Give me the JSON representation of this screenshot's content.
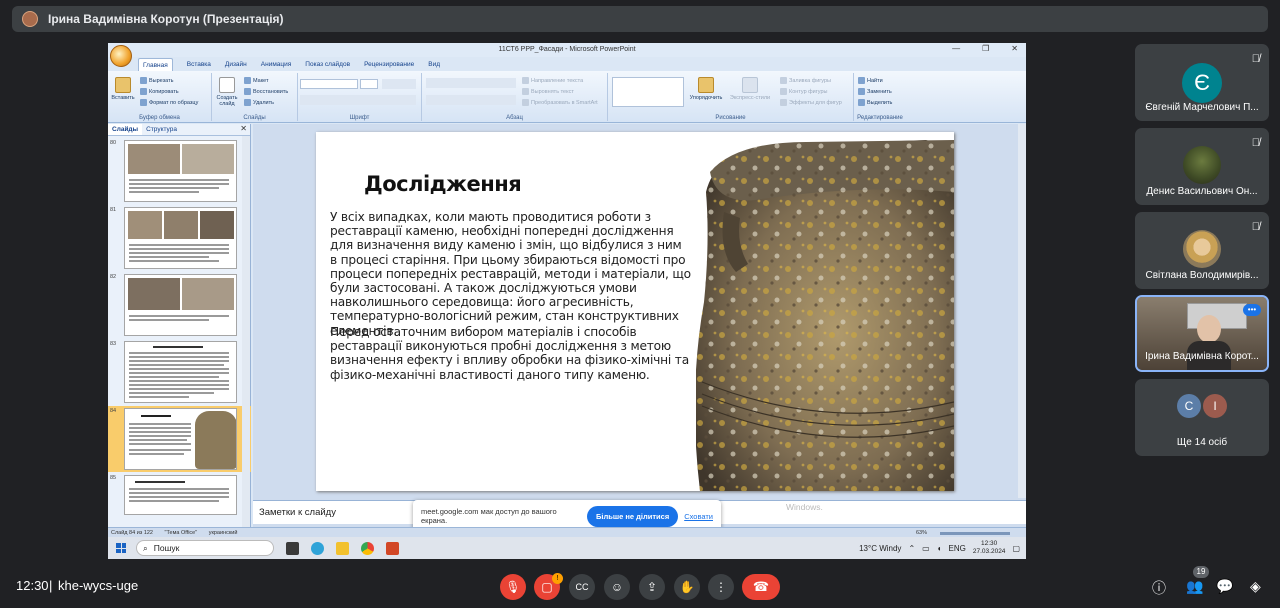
{
  "meet": {
    "presenter_bar": "Ірина Вадимівна Коротун (Презентація)",
    "meeting_time": "12:30",
    "meeting_code": "khe-wycs-uge",
    "people_count": "19",
    "more_people_label": "Ще 14 осіб",
    "participants": [
      {
        "name": "Євгеній Марчелович П...",
        "initial": "Є",
        "avatar_color": "#00838f"
      },
      {
        "name": "Денис Васильович Он..."
      },
      {
        "name": "Світлана Володимирів..."
      },
      {
        "name": "Ірина Вадимівна Корот..."
      }
    ],
    "more_initials": [
      "С",
      "І"
    ],
    "controls": [
      "mic-off-icon",
      "camera-off-icon",
      "captions-icon",
      "emoji-icon",
      "present-icon",
      "raise-hand-icon",
      "more-icon",
      "hang-up-icon"
    ],
    "right_controls": [
      "info-icon",
      "people-icon",
      "chat-icon",
      "activities-icon"
    ],
    "accent": "#ea4335"
  },
  "ppt": {
    "window_title": "11СТ6 PPP_Фасади - Microsoft PowerPoint",
    "tabs": [
      "Главная",
      "Вставка",
      "Дизайн",
      "Анимация",
      "Показ слайдов",
      "Рецензирование",
      "Вид"
    ],
    "clipboard": {
      "paste": "Вставить",
      "cut": "Вырезать",
      "copy": "Копировать",
      "format": "Формат по образцу",
      "label": "Буфер обмена"
    },
    "slides_group": {
      "create": "Создать слайд",
      "layout": "Макет",
      "reset": "Восстановить",
      "delete": "Удалить",
      "label": "Слайды"
    },
    "font_group": {
      "label": "Шрифт"
    },
    "para_group": {
      "direction": "Направление текста",
      "align": "Выровнять текст",
      "smartart": "Преобразовать в SmartArt",
      "label": "Абзац"
    },
    "draw_group": {
      "arrange": "Упорядочить",
      "styles": "Экспресс-стили",
      "fill": "Заливка фигуры",
      "outline": "Контур фигуры",
      "effects": "Эффекты для фигур",
      "label": "Рисование"
    },
    "edit_group": {
      "find": "Найти",
      "replace": "Заменить",
      "select": "Выделить",
      "label": "Редактирование"
    },
    "left_tabs": [
      "Слайды",
      "Структура"
    ],
    "thumb_numbers": [
      "80",
      "81",
      "82",
      "83",
      "84",
      "85"
    ],
    "slide": {
      "title": "Дослідження",
      "p1": "У всіх випадках, коли мають проводитися роботи з реставрації каменю, необхідні попередні дослідження для визначення виду каменю і змін, що відбулися з ним в процесі старіння. При цьому збираються відомості про процеси попередніх реставрацій, методи і матеріали, що були застосовані. А також досліджуються умови навколишнього середовища: його агресивність, температурно-вологісний режим, стан конструктивних елементів.",
      "p2": "Перед остаточним вибором матеріалів і способів реставрації виконуються пробні дослідження з метою визначення ефекту і впливу обробки на фізико-хімічні та фізико-механічні властивості даного типу каменю."
    },
    "notes": "Заметки к слайду",
    "status": [
      "Слайд 84 из 122",
      "\"Тема Office\"",
      "украинский"
    ],
    "zoom": "63%",
    "share_msg": "meet.google.com мак доступ до вашого екрана.",
    "stop_share": "Більше не ділитися",
    "hide": "Сховати",
    "windows_wm": "Windows.",
    "taskbar": {
      "search": "Пошук",
      "weather": "13°C  Windy",
      "lang": "ENG",
      "time": "12:30",
      "date": "27.03.2024"
    }
  }
}
